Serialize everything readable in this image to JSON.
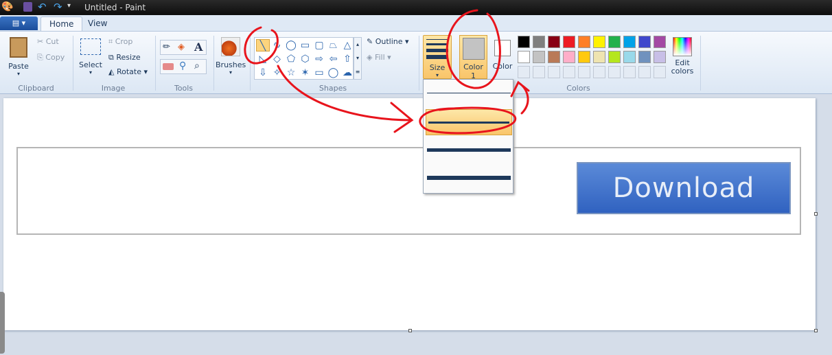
{
  "window": {
    "title": "Untitled - Paint"
  },
  "tabs": [
    {
      "label": "Home"
    },
    {
      "label": "View"
    }
  ],
  "clipboard": {
    "paste": "Paste",
    "cut": "Cut",
    "copy": "Copy",
    "group": "Clipboard"
  },
  "image": {
    "select": "Select",
    "crop": "Crop",
    "resize": "Resize",
    "rotate": "Rotate",
    "group": "Image"
  },
  "tools": {
    "group": "Tools"
  },
  "brushes": {
    "label": "Brushes"
  },
  "shapes": {
    "outline": "Outline",
    "fill": "Fill",
    "group": "Shapes",
    "icons": [
      "╲",
      "∿",
      "◯",
      "▭",
      "▢",
      "⏢",
      "△",
      "◺",
      "◇",
      "⬠",
      "⬡",
      "⇨",
      "⇦",
      "⇧",
      "⇩",
      "✧",
      "☆",
      "✶",
      "▭",
      "◯",
      "☁"
    ]
  },
  "size": {
    "label": "Size",
    "selected_index": 1
  },
  "colors": {
    "color1": "Color",
    "color1_num": "1",
    "color2": "Color",
    "group": "Colors",
    "edit": "Edit colors",
    "color1_value": "#c3c3c3",
    "color2_value": "#ffffff",
    "palette": [
      "#000000",
      "#7f7f7f",
      "#880015",
      "#ed1c24",
      "#ff7f27",
      "#fff200",
      "#22b14c",
      "#00a2e8",
      "#3f48cc",
      "#a349a4",
      "#ffffff",
      "#c3c3c3",
      "#b97a57",
      "#ffaec9",
      "#ffc90e",
      "#efe4b0",
      "#b5e61d",
      "#99d9ea",
      "#7092be",
      "#c8bfe7"
    ]
  },
  "canvas": {
    "button_text": "Download"
  },
  "annotation_color": "#e8141c"
}
